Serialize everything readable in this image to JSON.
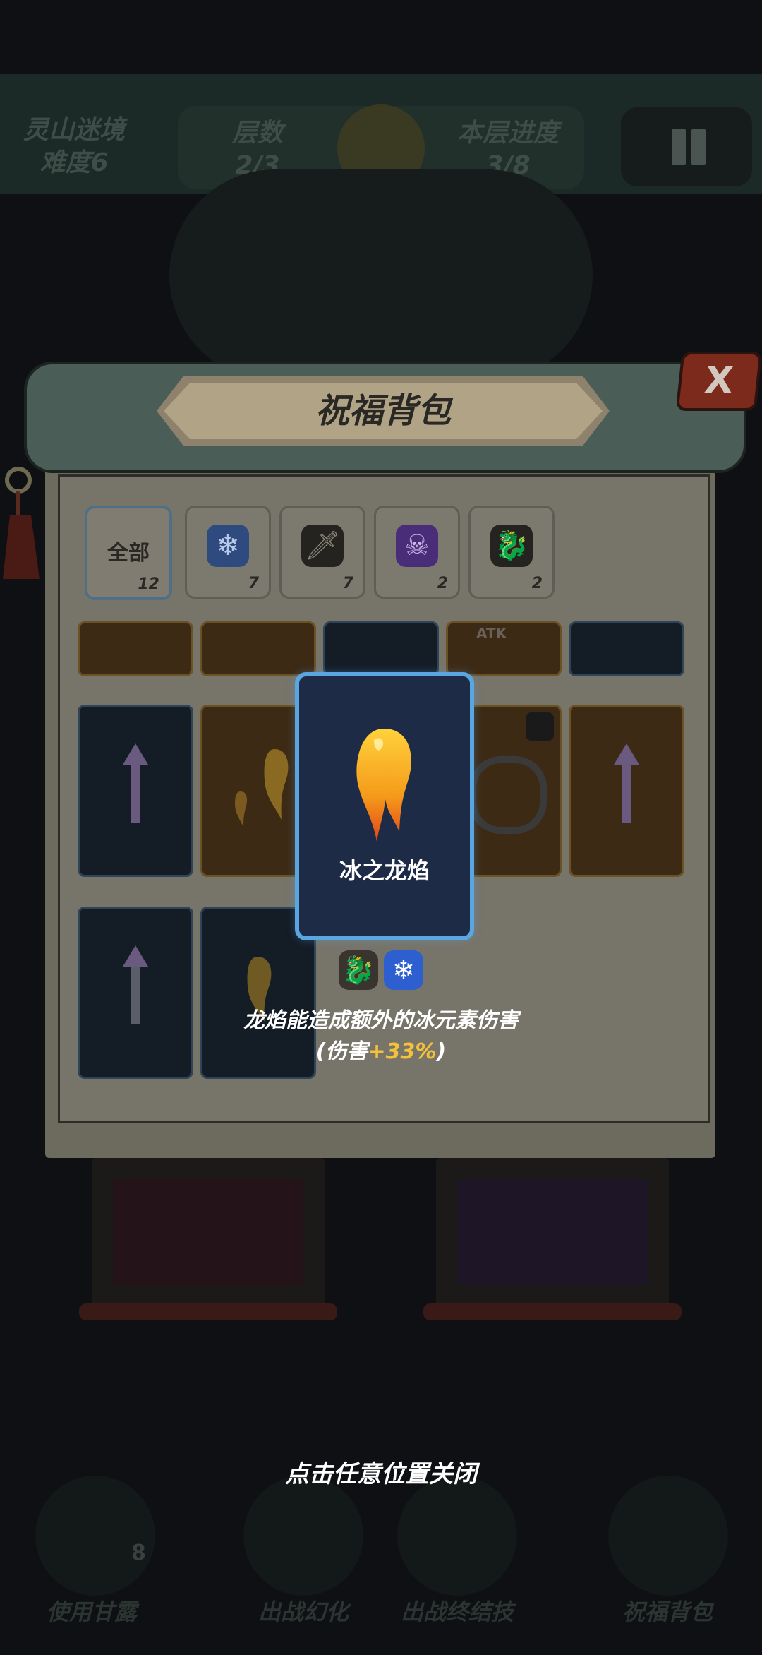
{
  "hud": {
    "stage_name": "灵山迷境",
    "difficulty": "难度6",
    "layer_label": "层数",
    "layer_value": "2/3",
    "progress_label": "本层进度",
    "progress_value": "3/8"
  },
  "bottom_bar": {
    "use_nectar": "使用甘露",
    "nectar_count": "8",
    "battle_transform": "出战幻化",
    "battle_finisher": "出战终结技",
    "blessing_bag": "祝福背包"
  },
  "dialog": {
    "title": "祝福背包",
    "close_symbol": "X",
    "tabs": [
      {
        "label": "全部",
        "count": "12",
        "icon": "all"
      },
      {
        "label": "",
        "count": "7",
        "icon": "snowflake-icon",
        "color": "#3a6bd6"
      },
      {
        "label": "",
        "count": "7",
        "icon": "sword-icon",
        "color": "#2a2a2a"
      },
      {
        "label": "",
        "count": "2",
        "icon": "skull-icon",
        "color": "#7b3fd0"
      },
      {
        "label": "",
        "count": "2",
        "icon": "dragon-icon",
        "color": "#2a2a2a"
      }
    ],
    "partial_card_text": "ATK"
  },
  "detail": {
    "name": "冰之龙焰",
    "tags": [
      "dragon-icon",
      "snowflake-icon"
    ],
    "description_line1": "龙焰能造成额外的冰元素伤害",
    "description_prefix": "(伤害",
    "description_value": "+33%",
    "description_suffix": ")",
    "accent_color": "#f4c13a"
  },
  "hint": "点击任意位置关闭"
}
